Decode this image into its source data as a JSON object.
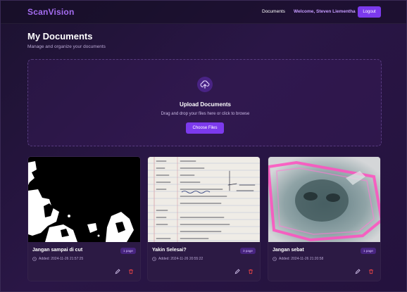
{
  "header": {
    "brand": "ScanVision",
    "nav_documents": "Documents",
    "welcome": "Welcome, Steven Liementha",
    "logout_label": "Logout"
  },
  "page": {
    "title": "My Documents",
    "subtitle": "Manage and organize your documents"
  },
  "upload": {
    "icon": "cloud-upload-icon",
    "title": "Upload Documents",
    "subtitle": "Drag and drop your files here or click to browse",
    "button_label": "Choose Files"
  },
  "documents": [
    {
      "title": "Jangan sampai di cut",
      "pages": "1 page",
      "added": "Added: 2024-11-26 21:57:25"
    },
    {
      "title": "Yakin Selesai?",
      "pages": "3 page",
      "added": "Added: 2024-11-26 20:55:22"
    },
    {
      "title": "Jangan sebat",
      "pages": "1 page",
      "added": "Added: 2024-11-26 21:20:58"
    }
  ],
  "colors": {
    "accent": "#7c3aed",
    "brand": "#a46cf0",
    "danger": "#ef4444"
  }
}
